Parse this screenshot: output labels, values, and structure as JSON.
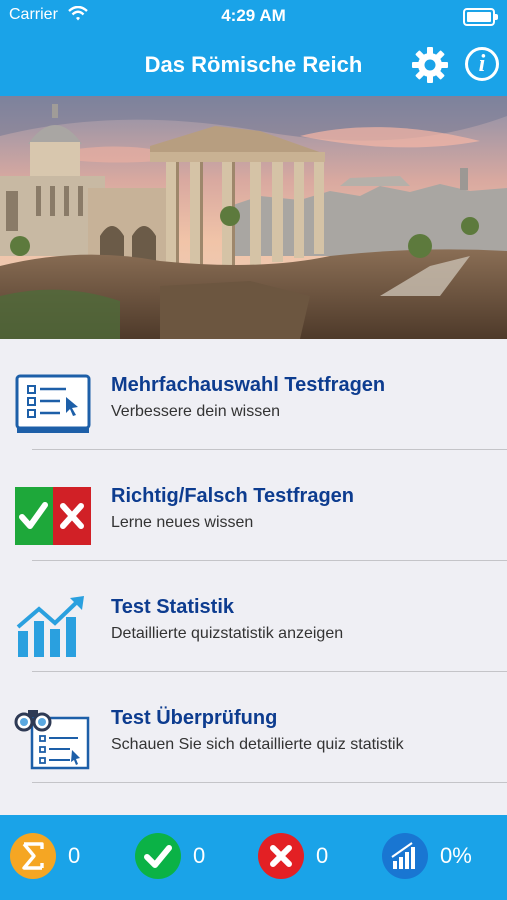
{
  "status_bar": {
    "carrier": "Carrier",
    "time": "4:29 AM"
  },
  "header": {
    "title": "Das Römische Reich"
  },
  "menu": [
    {
      "label": "Mehrfachauswahl Testfragen",
      "description": "Verbessere dein wissen",
      "icon": "checklist-icon"
    },
    {
      "label": "Richtig/Falsch Testfragen",
      "description": "Lerne neues wissen",
      "icon": "true-false-icon"
    },
    {
      "label": "Test Statistik",
      "description": "Detaillierte quizstatistik anzeigen",
      "icon": "bar-chart-icon"
    },
    {
      "label": "Test Überprüfung",
      "description": "Schauen Sie sich detaillierte quiz statistik",
      "icon": "review-icon"
    }
  ],
  "stats": {
    "total": "0",
    "correct": "0",
    "wrong": "0",
    "percent": "0%"
  },
  "colors": {
    "primary": "#1aa3e8",
    "title_text": "#0d3c8f",
    "sum": "#f5a623",
    "correct": "#0bb246",
    "wrong": "#e32024",
    "percent": "#1976d2"
  }
}
